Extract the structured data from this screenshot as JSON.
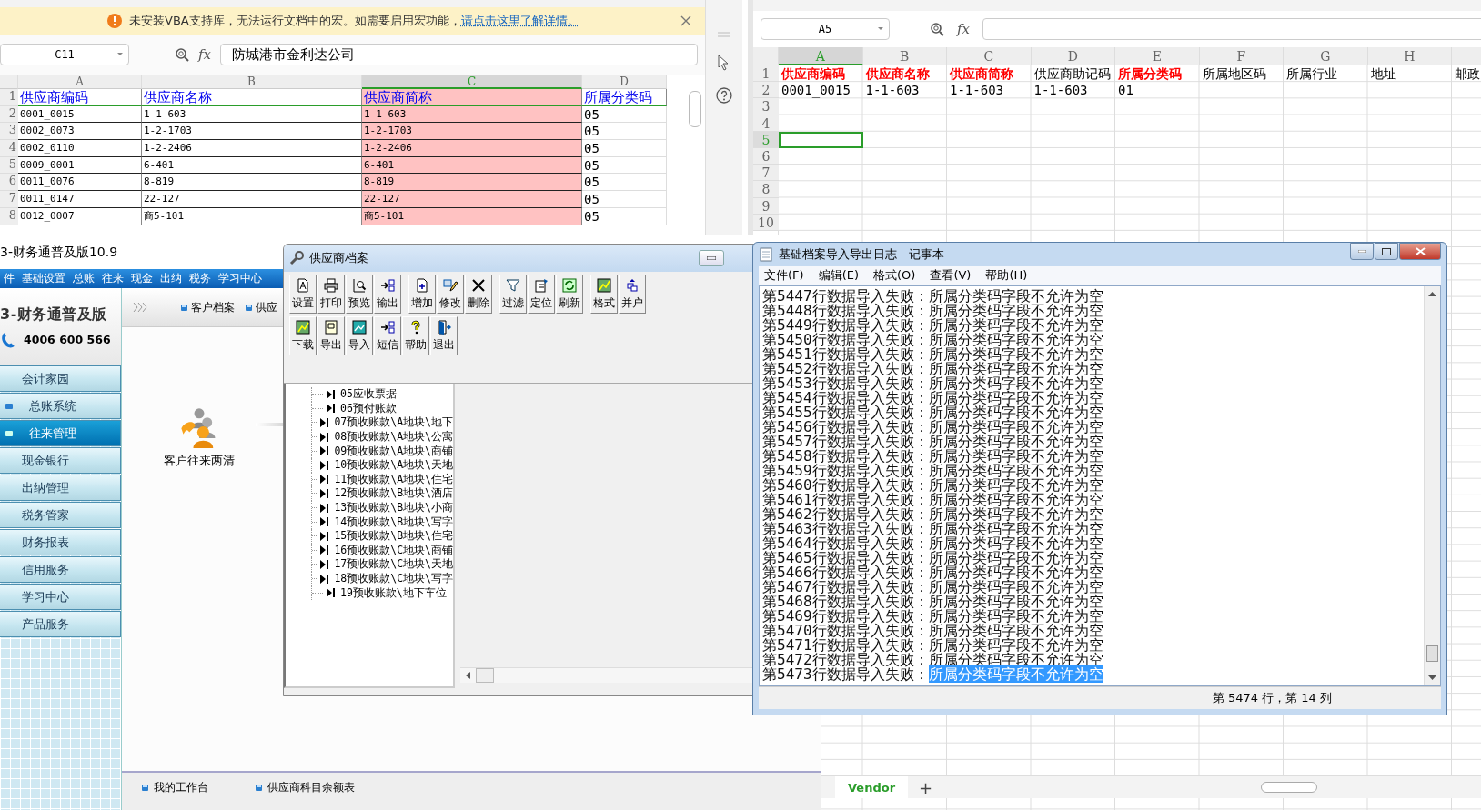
{
  "left_spreadsheet": {
    "info_bar": {
      "message": "未安装VBA支持库，无法运行文档中的宏。如需要启用宏功能，",
      "link": "请点击这里了解详情。"
    },
    "name_box": "C11",
    "fx_label": "fx",
    "formula": "防城港市金利达公司",
    "columns": [
      {
        "label": "A",
        "selected": false,
        "highlighted": false
      },
      {
        "label": "B",
        "selected": false,
        "highlighted": false
      },
      {
        "label": "C",
        "selected": true,
        "highlighted": true
      },
      {
        "label": "D",
        "selected": false,
        "highlighted": false
      }
    ],
    "header_row": {
      "number": "1",
      "cells": [
        "供应商编码",
        "供应商名称",
        "供应商简称",
        "所属分类码"
      ]
    },
    "rows": [
      {
        "number": "2",
        "cells": [
          "0001_0015",
          "1-1-603",
          "1-1-603",
          "05"
        ]
      },
      {
        "number": "3",
        "cells": [
          "0002_0073",
          "1-2-1703",
          "1-2-1703",
          "05"
        ]
      },
      {
        "number": "4",
        "cells": [
          "0002_0110",
          "1-2-2406",
          "1-2-2406",
          "05"
        ]
      },
      {
        "number": "5",
        "cells": [
          "0009_0001",
          "6-401",
          "6-401",
          "05"
        ]
      },
      {
        "number": "6",
        "cells": [
          "0011_0076",
          "8-819",
          "8-819",
          "05"
        ]
      },
      {
        "number": "7",
        "cells": [
          "0011_0147",
          "22-127",
          "22-127",
          "05"
        ]
      },
      {
        "number": "8",
        "cells": [
          "0012_0007",
          "商5-101",
          "商5-101",
          "05"
        ]
      }
    ]
  },
  "right_spreadsheet": {
    "name_box": "A5",
    "fx_label": "fx",
    "columns": [
      {
        "label": "A",
        "selected": true
      },
      {
        "label": "B",
        "selected": false
      },
      {
        "label": "C",
        "selected": false
      },
      {
        "label": "D",
        "selected": false
      },
      {
        "label": "E",
        "selected": false
      },
      {
        "label": "F",
        "selected": false
      },
      {
        "label": "G",
        "selected": false
      },
      {
        "label": "H",
        "selected": false
      }
    ],
    "header_row": {
      "number": "1",
      "cells": [
        {
          "text": "供应商编码",
          "required": true
        },
        {
          "text": "供应商名称",
          "required": true
        },
        {
          "text": "供应商简称",
          "required": true
        },
        {
          "text": "供应商助记码",
          "required": false
        },
        {
          "text": "所属分类码",
          "required": true
        },
        {
          "text": "所属地区码",
          "required": false
        },
        {
          "text": "所属行业",
          "required": false
        },
        {
          "text": "地址",
          "required": false
        },
        {
          "text": "邮政",
          "required": false
        }
      ]
    },
    "rows": [
      {
        "number": "2",
        "selected": false,
        "cells": [
          "0001_0015",
          "1-1-603",
          "1-1-603",
          "1-1-603",
          "01"
        ]
      },
      {
        "number": "3",
        "selected": false,
        "cells": []
      },
      {
        "number": "4",
        "selected": false,
        "cells": []
      },
      {
        "number": "5",
        "selected": true,
        "cells": []
      },
      {
        "number": "6",
        "selected": false,
        "cells": []
      },
      {
        "number": "7",
        "selected": false,
        "cells": []
      },
      {
        "number": "8",
        "selected": false,
        "cells": []
      },
      {
        "number": "9",
        "selected": false,
        "cells": []
      },
      {
        "number": "10",
        "selected": false,
        "cells": []
      }
    ],
    "sheet_tabs": [
      {
        "label": "Vendor",
        "selected": true
      }
    ],
    "add_sheet": "+"
  },
  "accounting_app": {
    "title": "3-财务通普及版10.9",
    "menu": [
      "件",
      "基础设置",
      "总账",
      "往来",
      "现金",
      "出纳",
      "税务",
      "学习中心"
    ],
    "logo_title": "3-财务通普及版",
    "phone": "4006 600 566",
    "nav": [
      {
        "label": "会计家园",
        "kind": "item",
        "selected": false
      },
      {
        "label": "总账系统",
        "kind": "group",
        "selected": false
      },
      {
        "label": "往来管理",
        "kind": "group",
        "selected": true
      },
      {
        "label": "现金银行",
        "kind": "item",
        "selected": false
      },
      {
        "label": "出纳管理",
        "kind": "item",
        "selected": false
      },
      {
        "label": "税务管家",
        "kind": "item",
        "selected": false
      },
      {
        "label": "财务报表",
        "kind": "item",
        "selected": false
      },
      {
        "label": "信用服务",
        "kind": "item",
        "selected": false
      },
      {
        "label": "学习中心",
        "kind": "item",
        "selected": false
      },
      {
        "label": "产品服务",
        "kind": "item",
        "selected": false
      }
    ],
    "breadcrumb": [
      "客户档案",
      "供应"
    ],
    "shortcut": "客户往来两清",
    "footer_links": [
      "我的工作台",
      "供应商科目余额表"
    ]
  },
  "vendor_dialog": {
    "title": "供应商档案",
    "toolbar_rows": [
      [
        [
          "设置",
          "打印",
          "预览",
          "输出"
        ],
        [
          "增加",
          "修改",
          "删除"
        ],
        [
          "过滤",
          "定位",
          "刷新"
        ],
        [
          "格式",
          "并户"
        ]
      ],
      [
        [
          "下载",
          "导出",
          "导入",
          "短信",
          "帮助",
          "退出"
        ]
      ]
    ],
    "tree_items": [
      "05应收票据",
      "06预付账款",
      "07预收账款\\A地块\\地下",
      "08预收账款\\A地块\\公寓",
      "09预收账款\\A地块\\商铺",
      "10预收账款\\A地块\\天地",
      "11预收账款\\A地块\\住宅",
      "12预收账款\\B地块\\酒店",
      "13预收账款\\B地块\\小商",
      "14预收账款\\B地块\\写字",
      "15预收账款\\B地块\\住宅",
      "16预收账款\\C地块\\商铺",
      "17预收账款\\C地块\\天地",
      "18预收账款\\C地块\\写字",
      "19预收账款\\地下车位"
    ]
  },
  "notepad": {
    "title": "基础档案导入导出日志 - 记事本",
    "menu": [
      "文件(F)",
      "编辑(E)",
      "格式(O)",
      "查看(V)",
      "帮助(H)"
    ],
    "lines": [
      {
        "prefix": "第5447行数据导入失败：",
        "message": "所属分类码字段不允许为空",
        "selected": false
      },
      {
        "prefix": "第5448行数据导入失败：",
        "message": "所属分类码字段不允许为空",
        "selected": false
      },
      {
        "prefix": "第5449行数据导入失败：",
        "message": "所属分类码字段不允许为空",
        "selected": false
      },
      {
        "prefix": "第5450行数据导入失败：",
        "message": "所属分类码字段不允许为空",
        "selected": false
      },
      {
        "prefix": "第5451行数据导入失败：",
        "message": "所属分类码字段不允许为空",
        "selected": false
      },
      {
        "prefix": "第5452行数据导入失败：",
        "message": "所属分类码字段不允许为空",
        "selected": false
      },
      {
        "prefix": "第5453行数据导入失败：",
        "message": "所属分类码字段不允许为空",
        "selected": false
      },
      {
        "prefix": "第5454行数据导入失败：",
        "message": "所属分类码字段不允许为空",
        "selected": false
      },
      {
        "prefix": "第5455行数据导入失败：",
        "message": "所属分类码字段不允许为空",
        "selected": false
      },
      {
        "prefix": "第5456行数据导入失败：",
        "message": "所属分类码字段不允许为空",
        "selected": false
      },
      {
        "prefix": "第5457行数据导入失败：",
        "message": "所属分类码字段不允许为空",
        "selected": false
      },
      {
        "prefix": "第5458行数据导入失败：",
        "message": "所属分类码字段不允许为空",
        "selected": false
      },
      {
        "prefix": "第5459行数据导入失败：",
        "message": "所属分类码字段不允许为空",
        "selected": false
      },
      {
        "prefix": "第5460行数据导入失败：",
        "message": "所属分类码字段不允许为空",
        "selected": false
      },
      {
        "prefix": "第5461行数据导入失败：",
        "message": "所属分类码字段不允许为空",
        "selected": false
      },
      {
        "prefix": "第5462行数据导入失败：",
        "message": "所属分类码字段不允许为空",
        "selected": false
      },
      {
        "prefix": "第5463行数据导入失败：",
        "message": "所属分类码字段不允许为空",
        "selected": false
      },
      {
        "prefix": "第5464行数据导入失败：",
        "message": "所属分类码字段不允许为空",
        "selected": false
      },
      {
        "prefix": "第5465行数据导入失败：",
        "message": "所属分类码字段不允许为空",
        "selected": false
      },
      {
        "prefix": "第5466行数据导入失败：",
        "message": "所属分类码字段不允许为空",
        "selected": false
      },
      {
        "prefix": "第5467行数据导入失败：",
        "message": "所属分类码字段不允许为空",
        "selected": false
      },
      {
        "prefix": "第5468行数据导入失败：",
        "message": "所属分类码字段不允许为空",
        "selected": false
      },
      {
        "prefix": "第5469行数据导入失败：",
        "message": "所属分类码字段不允许为空",
        "selected": false
      },
      {
        "prefix": "第5470行数据导入失败：",
        "message": "所属分类码字段不允许为空",
        "selected": false
      },
      {
        "prefix": "第5471行数据导入失败：",
        "message": "所属分类码字段不允许为空",
        "selected": false
      },
      {
        "prefix": "第5472行数据导入失败：",
        "message": "所属分类码字段不允许为空",
        "selected": false
      },
      {
        "prefix": "第5473行数据导入失败：",
        "message": "所属分类码字段不允许为空",
        "selected": true
      }
    ],
    "status": "第 5474 行，第 14 列"
  }
}
